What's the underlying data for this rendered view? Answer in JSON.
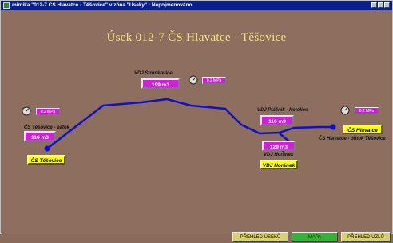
{
  "window": {
    "title": "mimika \"012-7 ČS Hlavatce - Těšovice\" v zóna \"Úseky\" : Nepojmenováno"
  },
  "heading": "Úsek 012-7 ČS Hlavatce - Těšovice",
  "nodes": {
    "strunkovice": {
      "name": "VDJ Strunkovice",
      "volume": "199 m3",
      "pressure": "0.2 MPa"
    },
    "tesovice": {
      "name": "ČS Těšovice - nátok",
      "volume": "116 m3",
      "pressure": "0.2 MPa",
      "station": "ČS Těšovice"
    },
    "ptacnik": {
      "name": "VDJ Ptáčník - Netolice",
      "volume": "116 m3"
    },
    "horanek": {
      "name": "VDJ Horánek",
      "volume": "129 m3",
      "station": "VDJ Horánek"
    },
    "hlavatce": {
      "name": "ČS Hlavatce - odtok Těšovice",
      "pressure": "0.2 MPa",
      "station": "ČS Hlavatce"
    }
  },
  "nav": {
    "useky": "PŘEHLED ÚSEKŮ",
    "mapa": "MAPA",
    "uzly": "PŘEHLED UZLŮ"
  },
  "colors": {
    "pipe": "#1010c8",
    "volume_bg": "#cc22d6",
    "station_bg": "#ffff00",
    "titlebar": "#0a1f8c",
    "heading": "#f2e58a"
  }
}
